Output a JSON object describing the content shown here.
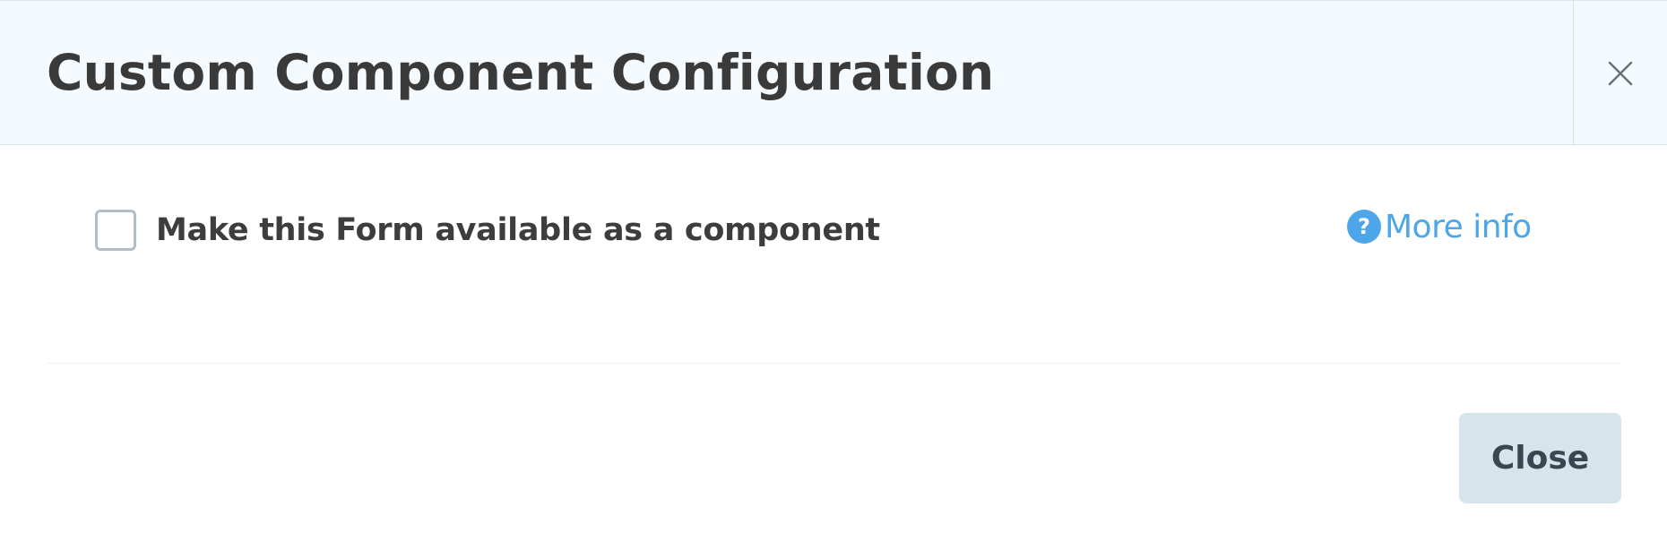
{
  "modal": {
    "title": "Custom Component Configuration",
    "close_icon": "close-icon"
  },
  "option": {
    "checkbox_checked": false,
    "label": "Make this Form available as a component"
  },
  "more_info": {
    "icon": "help-circle-icon",
    "icon_glyph": "?",
    "label": "More info"
  },
  "footer": {
    "close_label": "Close"
  },
  "colors": {
    "header_bg": "#f4fafd",
    "title_text": "#3a3a3a",
    "link_blue": "#4ea6ea",
    "checkbox_border": "#aebfcb",
    "button_bg": "#d6e5ec",
    "button_text": "#3b4650"
  }
}
